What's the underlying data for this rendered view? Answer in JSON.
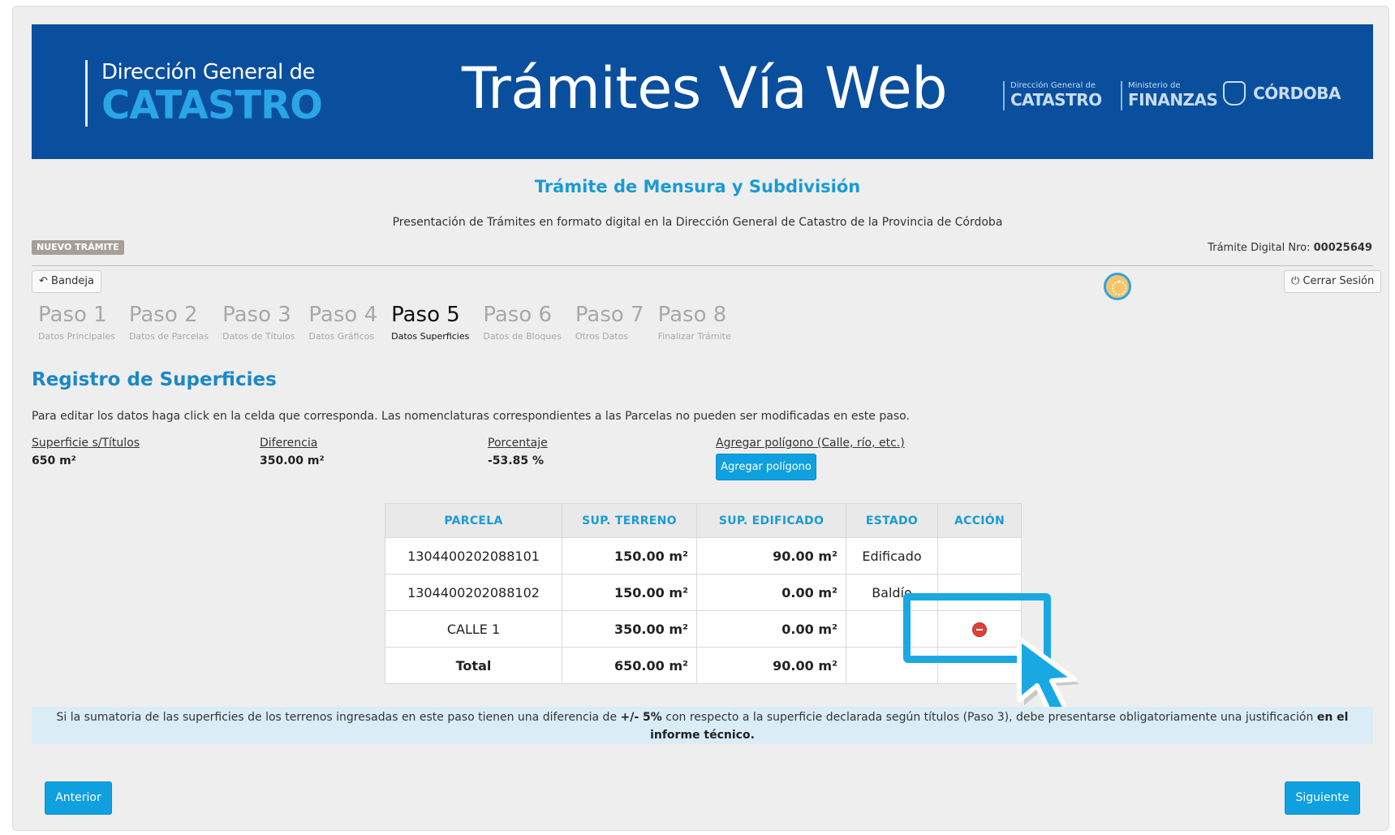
{
  "header": {
    "brand_top": "Dirección General de",
    "brand_bottom": "CATASTRO",
    "title": "Trámites Vía Web",
    "logo1_top": "Dirección General de",
    "logo1_bottom": "CATASTRO",
    "logo2_top": "Ministerio de",
    "logo2_bottom": "FINANZAS",
    "logo3_bottom": "CÓRDOBA"
  },
  "page": {
    "heading": "Trámite de Mensura y Subdivisión",
    "subheading": "Presentación de Trámites en formato digital en la Dirección General de Catastro de la Provincia de Córdoba",
    "badge": "NUEVO TRÁMITE",
    "tramite_label": "Trámite Digital Nro:",
    "tramite_number": "00025649"
  },
  "toolbar": {
    "bandeja": "Bandeja",
    "cerrar_sesion": "Cerrar Sesión"
  },
  "steps": [
    {
      "title": "Paso 1",
      "sub": "Datos Principales"
    },
    {
      "title": "Paso 2",
      "sub": "Datos de Parcelas"
    },
    {
      "title": "Paso 3",
      "sub": "Datos de Títulos"
    },
    {
      "title": "Paso 4",
      "sub": "Datos Gráficos"
    },
    {
      "title": "Paso 5",
      "sub": "Datos Superficies"
    },
    {
      "title": "Paso 6",
      "sub": "Datos de Bloques"
    },
    {
      "title": "Paso 7",
      "sub": "Otros Datos"
    },
    {
      "title": "Paso 8",
      "sub": "Finalizar Trámite"
    }
  ],
  "active_step": 5,
  "section": {
    "title": "Registro de Superficies",
    "instructions": "Para editar los datos haga click en la celda que corresponda. Las nomenclaturas correspondientes a las Parcelas no pueden ser modificadas en este paso."
  },
  "summary": {
    "superficie_label": "Superficie s/Títulos",
    "superficie_value": "650 m²",
    "diferencia_label": "Diferencia",
    "diferencia_value": "350.00 m²",
    "porcentaje_label": "Porcentaje",
    "porcentaje_value": "-53.85 %",
    "agregar_label": "Agregar polígono (Calle, río, etc.)",
    "agregar_button": "Agregar polígono"
  },
  "table": {
    "headers": [
      "PARCELA",
      "SUP. TERRENO",
      "SUP. EDIFICADO",
      "ESTADO",
      "ACCIÓN"
    ],
    "rows": [
      [
        "1304400202088101",
        "150.00 m²",
        "90.00 m²",
        "Edificado",
        ""
      ],
      [
        "1304400202088102",
        "150.00 m²",
        "0.00 m²",
        "Baldío",
        ""
      ],
      [
        "CALLE 1",
        "350.00 m²",
        "0.00 m²",
        "",
        "delete"
      ]
    ],
    "total": [
      "Total",
      "650.00 m²",
      "90.00 m²",
      "",
      ""
    ]
  },
  "notice": {
    "part1": "Si la sumatoria de las superficies de los terrenos ingresadas en este paso tienen una diferencia de ",
    "bold1": "+/- 5%",
    "part2": " con respecto a la superficie declarada según títulos (Paso 3), debe presentarse obligatoriamente una justificación ",
    "bold2": "en el informe técnico."
  },
  "nav": {
    "anterior": "Anterior",
    "siguiente": "Siguiente"
  },
  "colors": {
    "banner": "#0a4f9e",
    "accent": "#1b9ad6",
    "button": "#0fa0df",
    "highlight": "#1aa8e3",
    "notice_bg": "#daedf7"
  }
}
